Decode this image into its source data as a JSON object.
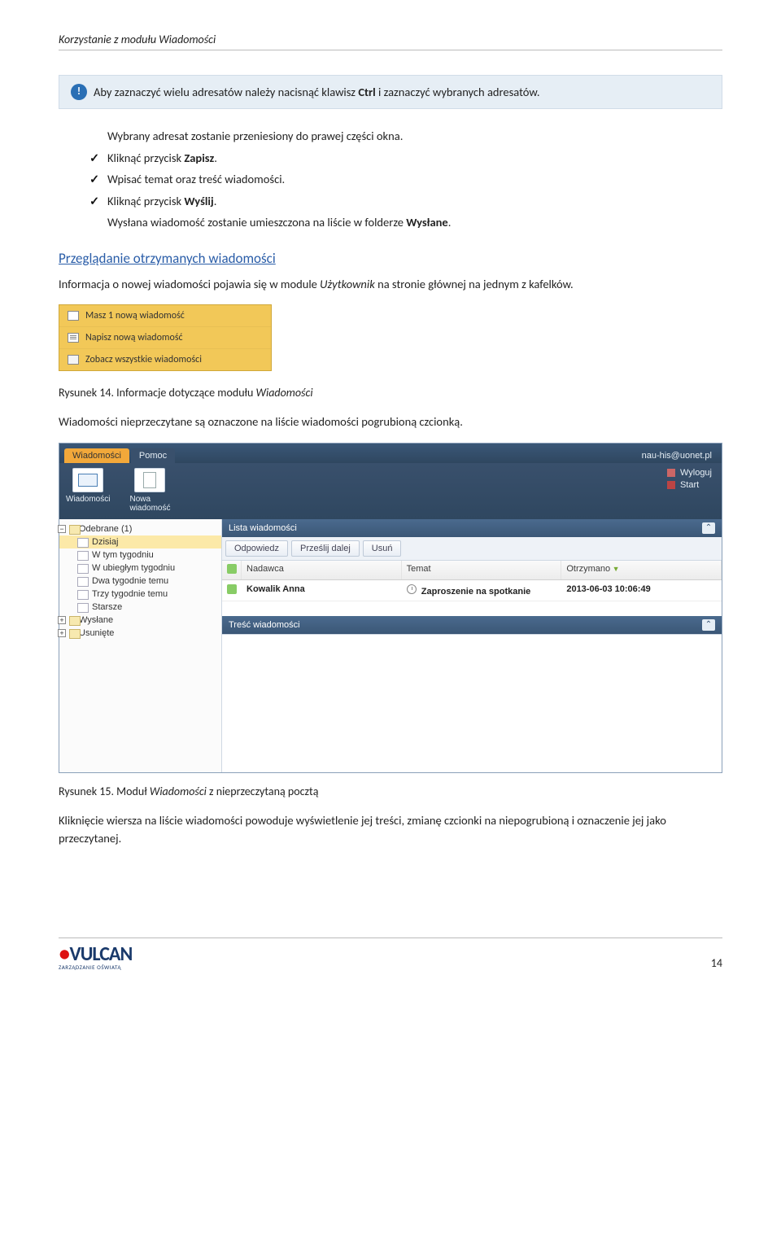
{
  "header": {
    "title": "Korzystanie z modułu Wiadomości"
  },
  "callout": {
    "text": "Aby zaznaczyć wielu adresatów należy nacisnąć klawisz Ctrl i zaznaczyć wybranych adresatów.",
    "ctrl": "Ctrl"
  },
  "steps": {
    "s1": "Wybrany adresat zostanie przeniesiony do prawej części okna.",
    "s2a": "Kliknąć przycisk ",
    "s2b": "Zapisz",
    "s2c": ".",
    "s3": "Wpisać temat oraz treść wiadomości.",
    "s4a": "Kliknąć przycisk ",
    "s4b": "Wyślij",
    "s4c": ".",
    "s5a": "Wysłana wiadomość zostanie umieszczona na liście w folderze ",
    "s5b": "Wysłane",
    "s5c": "."
  },
  "section_link": "Przeglądanie otrzymanych wiadomości",
  "para1a": "Informacja o nowej wiadomości pojawia się w module ",
  "para1b": "Użytkownik",
  "para1c": " na stronie głównej na jednym z kafelków.",
  "widget": {
    "row1": "Masz 1 nową wiadomość",
    "row2": "Napisz nową wiadomość",
    "row3": "Zobacz wszystkie wiadomości"
  },
  "caption14a": "Rysunek 14.   Informacje dotyczące modułu ",
  "caption14b": "Wiadomości",
  "para2": "Wiadomości nieprzeczytane są oznaczone na liście wiadomości pogrubioną czcionką.",
  "app": {
    "tab1": "Wiadomości",
    "tab2": "Pomoc",
    "user": "nau-his@uonet.pl",
    "rib_wiad": "Wiadomości",
    "rib_nowa": "Nowa\nwiadomość",
    "link_logout": "Wyloguj",
    "link_start": "Start",
    "tree": {
      "inbox": "Odebrane (1)",
      "today": "Dzisiaj",
      "thisweek": "W tym tygodniu",
      "lastweek": "W ubiegłym tygodniu",
      "two": "Dwa tygodnie temu",
      "three": "Trzy tygodnie temu",
      "older": "Starsze",
      "sent": "Wysłane",
      "trash": "Usunięte"
    },
    "panel_list": "Lista wiadomości",
    "btn_reply": "Odpowiedz",
    "btn_fwd": "Prześlij dalej",
    "btn_del": "Usuń",
    "col_sender": "Nadawca",
    "col_subject": "Temat",
    "col_recv": "Otrzymano",
    "row_sender": "Kowalik Anna",
    "row_subject": "Zaproszenie na spotkanie",
    "row_date": "2013-06-03 10:06:49",
    "panel_body": "Treść wiadomości"
  },
  "caption15a": "Rysunek 15.   Moduł ",
  "caption15b": "Wiadomości",
  "caption15c": " z nieprzeczytaną pocztą",
  "para3": "Kliknięcie wiersza na liście wiadomości powoduje wyświetlenie jej treści, zmianę czcionki na niepogrubioną i oznaczenie jej jako przeczytanej.",
  "footer": {
    "brand": "VULCAN",
    "tagline": "ZARZĄDZANIE OŚWIATĄ",
    "page": "14"
  }
}
